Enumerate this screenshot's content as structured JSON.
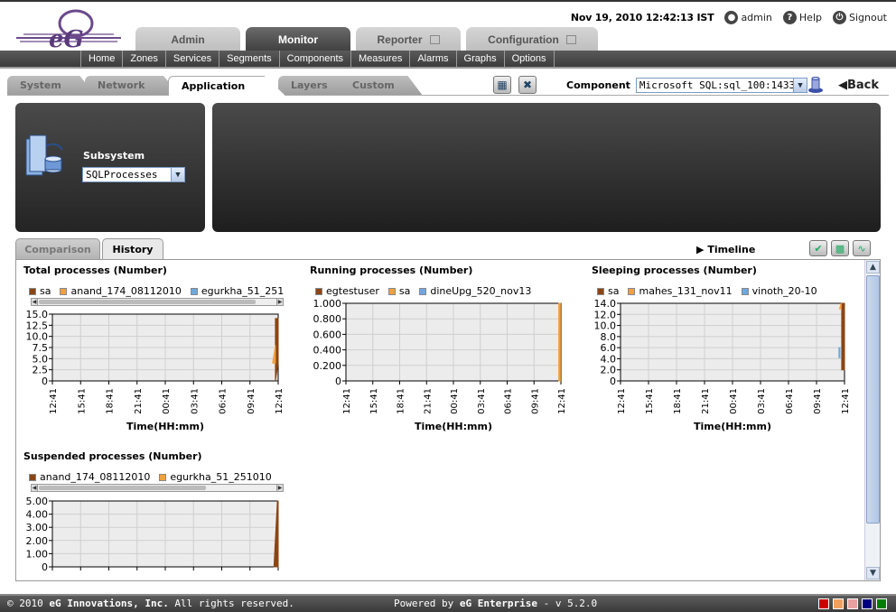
{
  "header": {
    "datetime": "Nov 19, 2010 12:42:13 IST",
    "user": "admin",
    "help": "Help",
    "signout": "Signout",
    "logo_text": "eG"
  },
  "main_tabs": [
    {
      "label": "Admin",
      "active": false,
      "external": false
    },
    {
      "label": "Monitor",
      "active": true,
      "external": false
    },
    {
      "label": "Reporter",
      "active": false,
      "external": true
    },
    {
      "label": "Configuration",
      "active": false,
      "external": true
    }
  ],
  "sub_nav": [
    "Home",
    "Zones",
    "Services",
    "Segments",
    "Components",
    "Measures",
    "Alarms",
    "Graphs",
    "Options"
  ],
  "layer_tabs": [
    {
      "label": "System",
      "active": false
    },
    {
      "label": "Network",
      "active": false
    },
    {
      "label": "Application",
      "active": true
    },
    {
      "label": "Layers",
      "active": false
    },
    {
      "label": "Custom",
      "active": false
    }
  ],
  "component": {
    "label": "Component",
    "value": "Microsoft SQL:sql_100:1433"
  },
  "back_label": "Back",
  "subsystem": {
    "label": "Subsystem",
    "value": "SQLProcesses"
  },
  "history_tabs": [
    {
      "label": "Comparison",
      "active": false
    },
    {
      "label": "History",
      "active": true
    }
  ],
  "timeline_label": "Timeline",
  "colors": {
    "series1": "#8b4513",
    "series2": "#f0a040",
    "series3": "#6fa8dc",
    "plot_bg": "#ececec",
    "grid": "#cfcfcf",
    "footer_themes": [
      "#cc0000",
      "#f0a060",
      "#e8a0a0",
      "#000080",
      "#008000"
    ]
  },
  "footer": {
    "copyright_pre": "© 2010 ",
    "company": "eG Innovations, Inc.",
    "copyright_post": " All rights reserved.",
    "powered_pre": "Powered by ",
    "product": "eG Enterprise",
    "version": " - v 5.2.0"
  },
  "chart_data": [
    {
      "type": "area",
      "title": "Total processes (Number)",
      "xlabel": "Time(HH:mm)",
      "x": [
        "12:41",
        "15:41",
        "18:41",
        "21:41",
        "00:41",
        "03:41",
        "06:41",
        "09:41",
        "12:41"
      ],
      "yticks": [
        "0",
        "2.5",
        "5.0",
        "7.5",
        "10.0",
        "12.5",
        "15.0"
      ],
      "ylim": [
        0,
        15
      ],
      "series": [
        {
          "name": "sa",
          "color": "#8b4513",
          "points": [
            [
              7.9,
              0
            ],
            [
              7.9,
              14
            ],
            [
              7.95,
              14
            ],
            [
              8,
              14
            ],
            [
              8,
              4
            ]
          ]
        },
        {
          "name": "anand_174_08112010",
          "color": "#f0a040",
          "points": [
            [
              7.8,
              4
            ],
            [
              7.9,
              8
            ],
            [
              7.9,
              4
            ]
          ]
        },
        {
          "name": "egurkha_51_251",
          "color": "#6fa8dc",
          "points": []
        }
      ]
    },
    {
      "type": "area",
      "title": "Running processes (Number)",
      "xlabel": "Time(HH:mm)",
      "x": [
        "12:41",
        "15:41",
        "18:41",
        "21:41",
        "00:41",
        "03:41",
        "06:41",
        "09:41",
        "12:41"
      ],
      "yticks": [
        "0",
        "0.200",
        "0.400",
        "0.600",
        "0.800",
        "1.000"
      ],
      "ylim": [
        0,
        1
      ],
      "series": [
        {
          "name": "egtestuser",
          "color": "#8b4513",
          "points": []
        },
        {
          "name": "sa",
          "color": "#f0a040",
          "points": [
            [
              7.92,
              0
            ],
            [
              7.92,
              1
            ],
            [
              7.98,
              1
            ],
            [
              7.98,
              0
            ]
          ]
        },
        {
          "name": "dineUpg_520_nov13",
          "color": "#6fa8dc",
          "points": []
        }
      ]
    },
    {
      "type": "area",
      "title": "Sleeping processes (Number)",
      "xlabel": "Time(HH:mm)",
      "x": [
        "12:41",
        "15:41",
        "18:41",
        "21:41",
        "00:41",
        "03:41",
        "06:41",
        "09:41",
        "12:41"
      ],
      "yticks": [
        "0",
        "2.0",
        "4.0",
        "6.0",
        "8.0",
        "10.0",
        "12.0",
        "14.0"
      ],
      "ylim": [
        0,
        14
      ],
      "series": [
        {
          "name": "sa",
          "color": "#8b4513",
          "points": [
            [
              7.9,
              2
            ],
            [
              7.9,
              14
            ],
            [
              8,
              14
            ],
            [
              8,
              2
            ]
          ]
        },
        {
          "name": "mahes_131_nov11",
          "color": "#f0a040",
          "points": [
            [
              7.82,
              13
            ],
            [
              7.88,
              14
            ],
            [
              7.88,
              13
            ]
          ]
        },
        {
          "name": "vinoth_20-10",
          "color": "#6fa8dc",
          "points": [
            [
              7.8,
              4.2
            ],
            [
              7.8,
              6
            ],
            [
              7.84,
              6
            ],
            [
              7.84,
              4.2
            ]
          ]
        }
      ]
    },
    {
      "type": "area",
      "title": "Suspended processes (Number)",
      "xlabel": "",
      "x": [
        "",
        "",
        "",
        "",
        "",
        "",
        "",
        "",
        ""
      ],
      "yticks": [
        "0",
        "1.00",
        "2.00",
        "3.00",
        "4.00",
        "5.00"
      ],
      "ylim": [
        0,
        5
      ],
      "series": [
        {
          "name": "anand_174_08112010",
          "color": "#8b4513",
          "points": [
            [
              7.85,
              0
            ],
            [
              7.97,
              5
            ],
            [
              8,
              5
            ],
            [
              8,
              0
            ]
          ]
        },
        {
          "name": "egurkha_51_251010",
          "color": "#f0a040",
          "points": []
        }
      ]
    }
  ]
}
